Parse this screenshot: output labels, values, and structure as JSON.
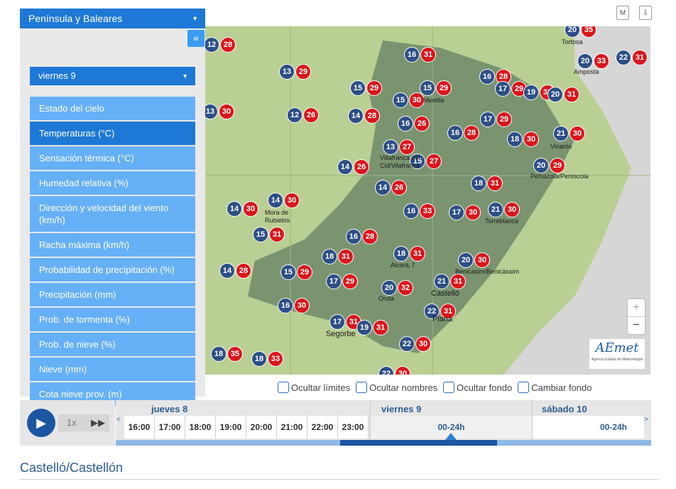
{
  "top_icons": {
    "m_icon": "M",
    "download_icon": "⇩"
  },
  "sidebar": {
    "region": "Península y Baleares",
    "collapse": "«",
    "day": "viernes 9",
    "menu": [
      "Estado del cielo",
      "Temperaturas (°C)",
      "Sensación térmica (°C)",
      "Humedad relativa (%)",
      "Dirección y velocidad del viento (km/h)",
      "Racha máxima (km/h)",
      "Probabilidad de precipitación (%)",
      "Precipitación (mm)",
      "Prob. de tormenta (%)",
      "Prob. de nieve (%)",
      "Nieve (mm)",
      "Cota nieve prov. (m)"
    ],
    "active_index": 1
  },
  "map": {
    "temps": [
      [
        "20",
        "35"
      ],
      [
        "12",
        "28"
      ],
      [
        "16",
        "31"
      ],
      [
        "20",
        "33"
      ],
      [
        "22",
        "31"
      ],
      [
        "13",
        "29"
      ],
      [
        "16",
        "28"
      ],
      [
        "15",
        "29"
      ],
      [
        "15",
        "29"
      ],
      [
        "17",
        "29"
      ],
      [
        "19",
        "31"
      ],
      [
        "20",
        "31"
      ],
      [
        "13",
        "30"
      ],
      [
        "12",
        "26"
      ],
      [
        "14",
        "28"
      ],
      [
        "15",
        "30"
      ],
      [
        "16",
        "26"
      ],
      [
        "17",
        "29"
      ],
      [
        "16",
        "28"
      ],
      [
        "18",
        "30"
      ],
      [
        "21",
        "30"
      ],
      [
        "13",
        "27"
      ],
      [
        "15",
        "27"
      ],
      [
        "14",
        "26"
      ],
      [
        "20",
        "29"
      ],
      [
        "14",
        "26"
      ],
      [
        "18",
        "31"
      ],
      [
        "14",
        "30"
      ],
      [
        "14",
        "30"
      ],
      [
        "16",
        "33"
      ],
      [
        "17",
        "30"
      ],
      [
        "21",
        "30"
      ],
      [
        "15",
        "31"
      ],
      [
        "16",
        "28"
      ],
      [
        "18",
        "31"
      ],
      [
        "18",
        "31"
      ],
      [
        "20",
        "30"
      ],
      [
        "14",
        "28"
      ],
      [
        "15",
        "29"
      ],
      [
        "17",
        "29"
      ],
      [
        "20",
        "32"
      ],
      [
        "21",
        "31"
      ],
      [
        "16",
        "30"
      ],
      [
        "22",
        "31"
      ],
      [
        "17",
        "31"
      ],
      [
        "19",
        "31"
      ],
      [
        "22",
        "30"
      ],
      [
        "18",
        "35"
      ],
      [
        "18",
        "33"
      ],
      [
        "22",
        "30"
      ]
    ],
    "cities": [
      "Tortosa",
      "Amposta",
      "Morella",
      "Vinaròs",
      "Villafranca del Cid/Vilafranca",
      "Peñíscola/Peníscola",
      "Mora de Rubielos",
      "Torreblanca",
      "Alcora, l'",
      "Benicasim/Benicàssim",
      "Onda",
      "Castelló",
      "Plana",
      "Segorbe"
    ],
    "zoom_in": "+",
    "zoom_out": "−",
    "logo": "AEmet",
    "logo_sub": "Agencia Estatal de Meteorología"
  },
  "options": [
    "Ocultar límites",
    "Ocultar nombres",
    "Ocultar fondo",
    "Cambiar fondo"
  ],
  "player": {
    "speed": "1x",
    "ff": "▶▶",
    "play": "▶"
  },
  "timeline": {
    "days": [
      "jueves 8",
      "viernes 9",
      "sábado 10"
    ],
    "hours": [
      "16:00",
      "17:00",
      "18:00",
      "19:00",
      "20:00",
      "21:00",
      "22:00",
      "23:00"
    ],
    "slots": [
      "00-24h",
      "00-24h"
    ],
    "left_arrow": "<",
    "right_arrow": ">"
  },
  "location": "Castelló/Castellón"
}
